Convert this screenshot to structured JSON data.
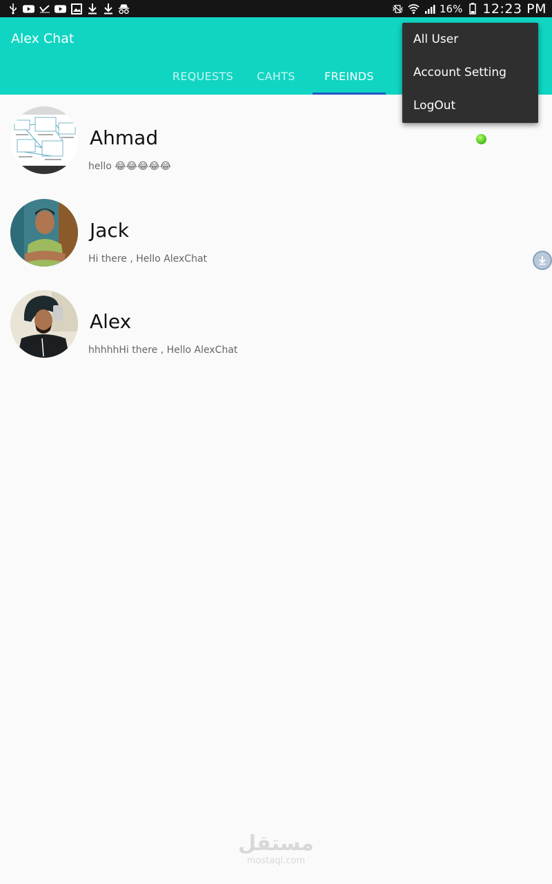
{
  "status_bar": {
    "battery_pct": "16%",
    "time": "12:23 PM",
    "left_icons": [
      "usb-icon",
      "youtube-icon",
      "check-icon",
      "youtube-icon",
      "gallery-icon",
      "download-icon",
      "download-icon",
      "incognito-icon"
    ],
    "right_icons": [
      "vibrate-mute-icon",
      "wifi-icon",
      "signal-icon",
      "battery-icon"
    ]
  },
  "app_bar": {
    "title": "Alex Chat",
    "background": "#10d5c3",
    "tabs": [
      {
        "label": "REQUESTS",
        "active": false
      },
      {
        "label": "CAHTS",
        "active": false
      },
      {
        "label": "FREINDS",
        "active": true
      }
    ],
    "indicator_color": "#2257c9"
  },
  "menu": {
    "items": [
      {
        "label": "All User"
      },
      {
        "label": "Account Setting"
      },
      {
        "label": "LogOut"
      }
    ]
  },
  "friends": [
    {
      "name": "Ahmad",
      "message": "hello 😂😂😂😂😂",
      "online": true,
      "avatar": "diagram-screenshot"
    },
    {
      "name": "Jack",
      "message": "Hi there , Hello AlexChat",
      "online": false,
      "avatar": "man-green-shirt"
    },
    {
      "name": "Alex",
      "message": "hhhhhHi there , Hello AlexChat",
      "online": false,
      "avatar": "man-selfie"
    }
  ],
  "watermark": {
    "arabic": "مستقل",
    "latin": "mostaql.com"
  }
}
